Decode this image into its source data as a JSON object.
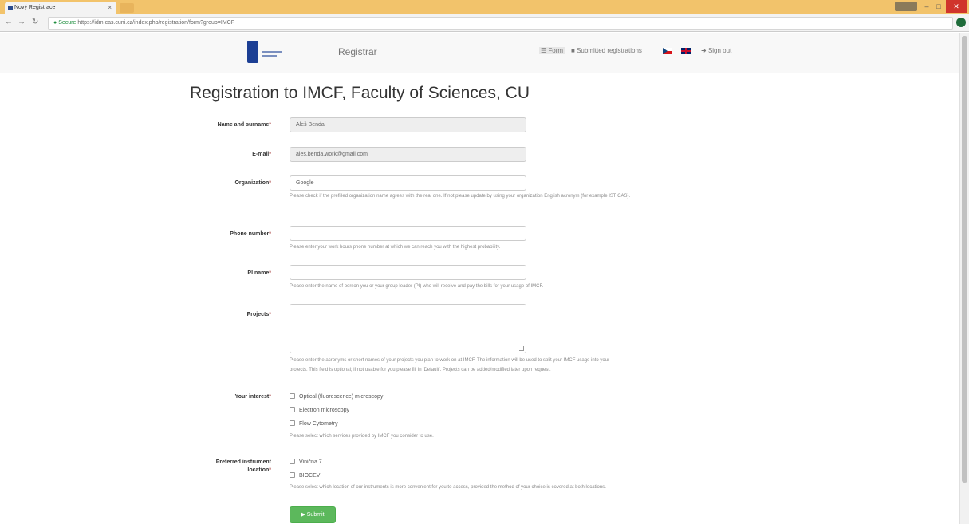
{
  "browser": {
    "tab_title": "Nový Registrace",
    "tab_close": "×",
    "url_secure": "Secure",
    "url": "https://idm.cas.cuni.cz/index.php/registration/form?group=IMCF",
    "minimize": "–",
    "maximize": "□",
    "close": "✕"
  },
  "navbar": {
    "brand": "Registrar",
    "form_label": "Form",
    "submitted_label": "Submitted registrations",
    "signout_label": "Sign out"
  },
  "page": {
    "title": "Registration to IMCF, Faculty of Sciences, CU",
    "required_marker": "*"
  },
  "fields": {
    "name": {
      "label": "Name and surname",
      "value": "Aleš Benda"
    },
    "email": {
      "label": "E-mail",
      "value": "ales.benda.work@gmail.com"
    },
    "organization": {
      "label": "Organization",
      "value": "Google",
      "help": "Please check if the prefilled organization name agrees with the real one. If not please update by using your organization English acronym (for example IST CAS)."
    },
    "phone": {
      "label": "Phone number",
      "value": "",
      "help": "Please enter your work hours phone number at which we can reach you with the highest probability."
    },
    "pi": {
      "label": "PI name",
      "value": "",
      "help": "Please enter the name of person you or your group leader (PI) who will receive and pay the bills for your usage of IMCF."
    },
    "projects": {
      "label": "Projects",
      "value": "",
      "help_line1": "Please enter the acronyms or short names of your projects you plan to work on at IMCF. The information will be used to split your IMCF usage into your",
      "help_line2": "projects. This field is optional; if not usable for you please fill in 'Default'. Projects can be added/modified later upon request."
    },
    "interest": {
      "label": "Your interest",
      "options": [
        "Optical (fluorescence) microscopy",
        "Electron microscopy",
        "Flow Cytometry"
      ],
      "help": "Please select which services provided by IMCF you consider to use."
    },
    "location": {
      "label_line1": "Preferred instrument",
      "label_line2": "location",
      "options": [
        "Vinična 7",
        "BIOCEV"
      ],
      "help": "Please select which location of our instruments is more convenient for you to access, provided the method of your choice is covered at both locations."
    }
  },
  "submit": {
    "label": "▶ Submit"
  }
}
